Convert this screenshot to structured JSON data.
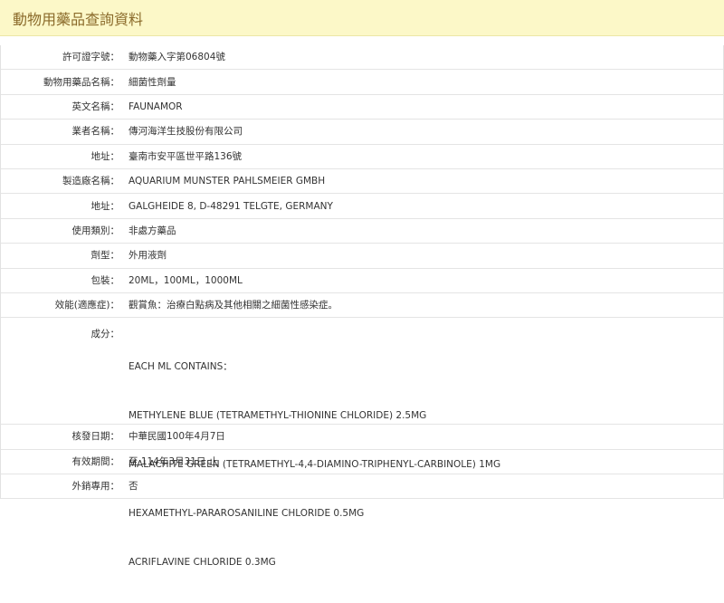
{
  "header": {
    "title": "動物用藥品查詢資料"
  },
  "fields": [
    {
      "key": "permit_no",
      "label": "許可證字號：",
      "value": "動物藥入字第06804號"
    },
    {
      "key": "product_name",
      "label": "動物用藥品名稱：",
      "value": "細菌性劑量"
    },
    {
      "key": "english_name",
      "label": "英文名稱：",
      "value": "FAUNAMOR"
    },
    {
      "key": "company_name",
      "label": "業者名稱：",
      "value": "傳河海洋生技股份有限公司"
    },
    {
      "key": "company_address",
      "label": "地址：",
      "value": "臺南市安平區世平路136號"
    },
    {
      "key": "manufacturer",
      "label": "製造廠名稱：",
      "value": "AQUARIUM MUNSTER PAHLSMEIER GMBH"
    },
    {
      "key": "manufacturer_address",
      "label": "地址：",
      "value": "GALGHEIDE 8, D-48291 TELGTE, GERMANY"
    },
    {
      "key": "usage_category",
      "label": "使用類別：",
      "value": "非處方藥品"
    },
    {
      "key": "dosage_form",
      "label": "劑型：",
      "value": "外用液劑"
    },
    {
      "key": "packaging",
      "label": "包裝：",
      "value": "20ML，100ML，1000ML"
    },
    {
      "key": "indications",
      "label": "效能(適應症)：",
      "value": "觀賞魚：治療白點病及其他相關之細菌性感染症。"
    }
  ],
  "ingredients": {
    "label": "成分：",
    "lines": [
      "EACH ML CONTAINS：",
      "METHYLENE BLUE (TETRAMETHYL-THIONINE CHLORIDE) 2.5MG",
      "MALACHITE GREEN (TETRAMETHYL-4,4-DIAMINO-TRIPHENYL-CARBINOLE) 1MG",
      "HEXAMETHYL-PARAROSANILINE CHLORIDE 0.5MG",
      "ACRIFLAVINE CHLORIDE 0.3MG"
    ]
  },
  "fields_after": [
    {
      "key": "issue_date",
      "label": "核發日期：",
      "value": "中華民國100年4月7日"
    },
    {
      "key": "validity",
      "label": "有效期間：",
      "value": "至 114年3月31日 止"
    },
    {
      "key": "export_only",
      "label": "外銷專用：",
      "value": "否"
    }
  ],
  "colors": {
    "header_bg": "#fcf8c8",
    "header_text": "#8a6a2a",
    "row_border": "#e4e4e4"
  }
}
